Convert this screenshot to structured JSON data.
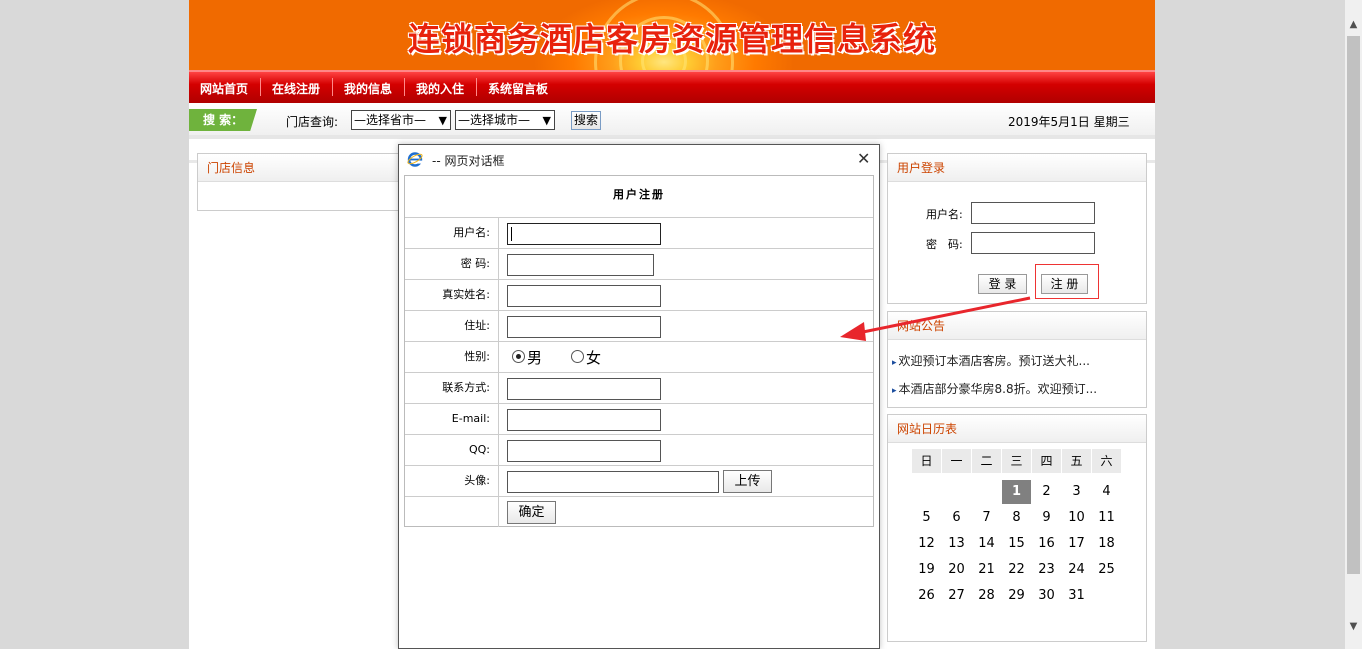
{
  "banner": {
    "title": "连锁商务酒店客房资源管理信息系统"
  },
  "nav": {
    "items": [
      "网站首页",
      "在线注册",
      "我的信息",
      "我的入住",
      "系统留言板"
    ]
  },
  "search": {
    "tag": "搜 索：",
    "label": "门店查询:",
    "province": "—选择省市—",
    "city": "—选择城市—",
    "button": "搜索",
    "date": "2019年5月1日 星期三"
  },
  "stores": {
    "title": "门店信息"
  },
  "login": {
    "title": "用户登录",
    "username_label": "用户名:",
    "password_label": "密　码:",
    "login_button": "登 录",
    "register_button": "注 册"
  },
  "notices": {
    "title": "网站公告",
    "items": [
      "欢迎预订本酒店客房。预订送大礼...",
      "本酒店部分豪华房8.8折。欢迎预订..."
    ]
  },
  "calendar": {
    "title": "网站日历表",
    "weekdays": [
      "日",
      "一",
      "二",
      "三",
      "四",
      "五",
      "六"
    ],
    "weeks": [
      [
        "",
        "",
        "",
        "1",
        "2",
        "3",
        "4"
      ],
      [
        "5",
        "6",
        "7",
        "8",
        "9",
        "10",
        "11"
      ],
      [
        "12",
        "13",
        "14",
        "15",
        "16",
        "17",
        "18"
      ],
      [
        "19",
        "20",
        "21",
        "22",
        "23",
        "24",
        "25"
      ],
      [
        "26",
        "27",
        "28",
        "29",
        "30",
        "31",
        ""
      ]
    ],
    "today": "1"
  },
  "dialog": {
    "title": "-- 网页对话框",
    "caption": "用户注册",
    "fields": {
      "username": "用户名:",
      "password": "密 码:",
      "realname": "真实姓名:",
      "address": "住址:",
      "gender": "性别:",
      "phone": "联系方式:",
      "email": "E-mail:",
      "qq": "QQ:",
      "avatar": "头像:"
    },
    "gender_male": "男",
    "gender_female": "女",
    "gender_selected": "男",
    "upload_button": "上传",
    "submit_button": "确定"
  },
  "colors": {
    "nav_red": "#d40000",
    "banner_orange": "#ff8a00",
    "title_red": "#e8220c",
    "section_title": "#cc4400",
    "arrow": "#e8262c"
  }
}
